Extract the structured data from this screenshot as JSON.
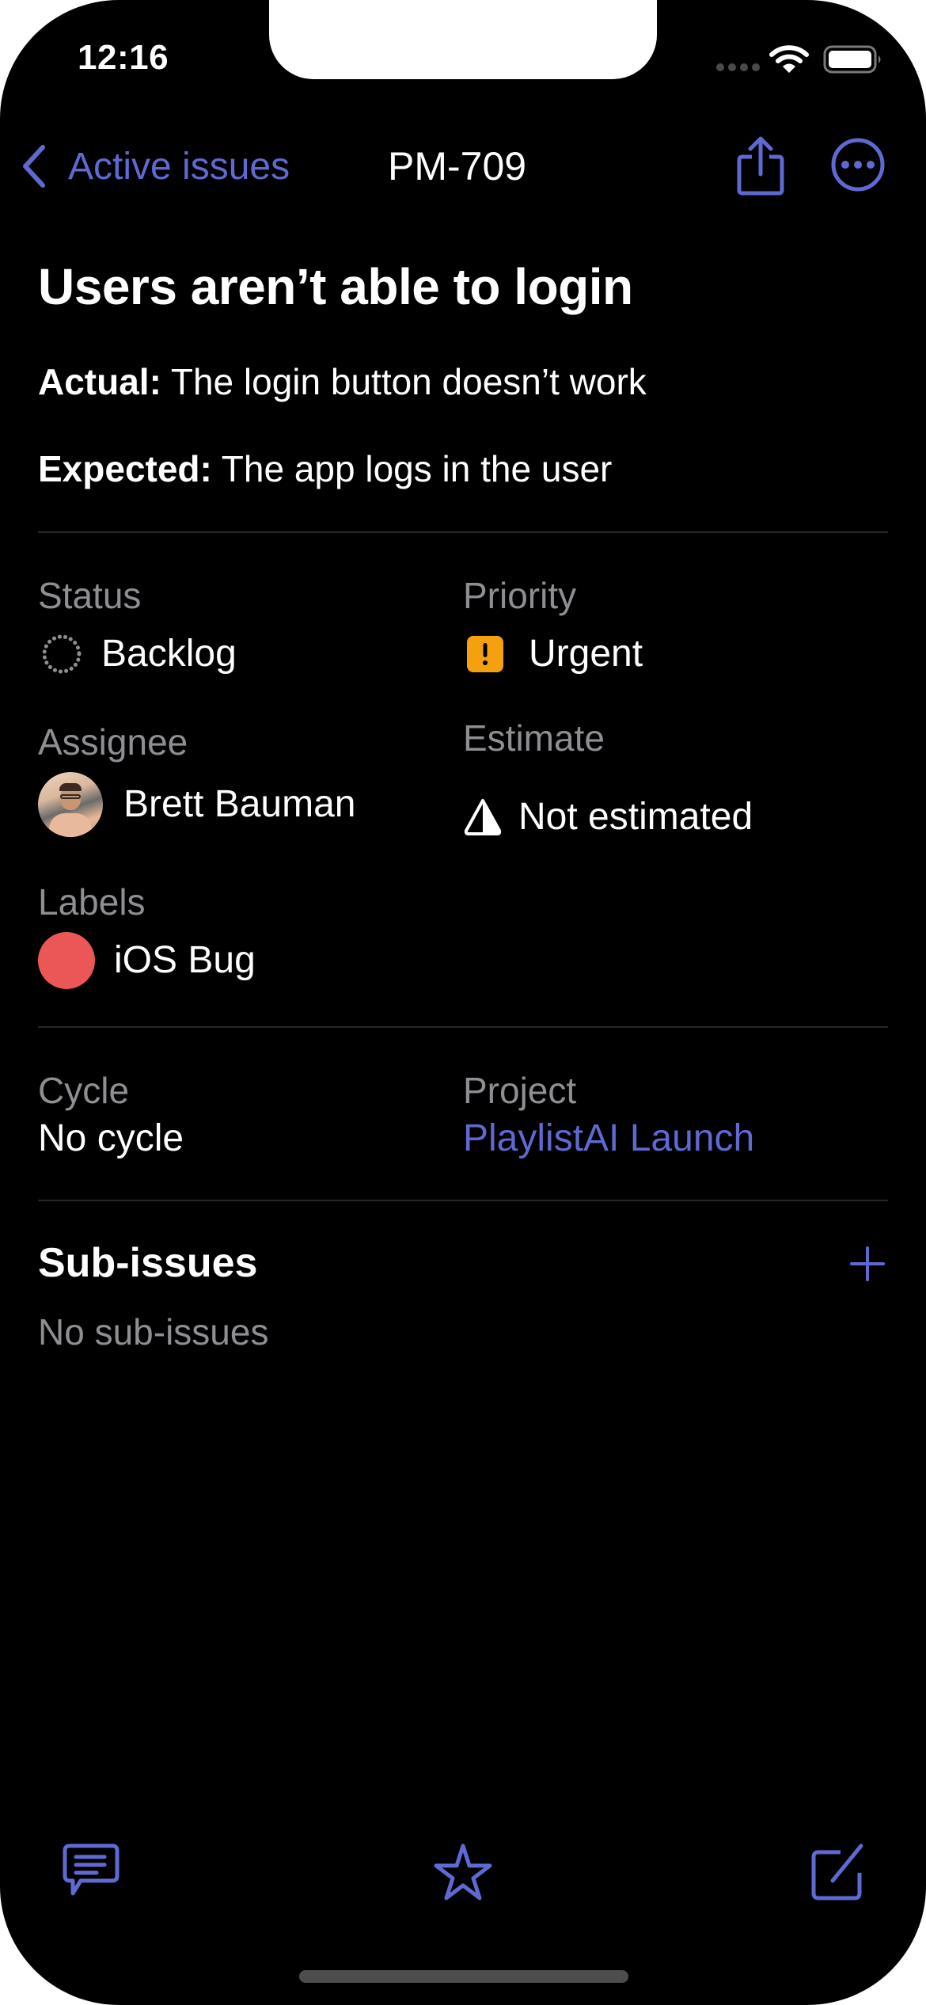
{
  "status_bar": {
    "time": "12:16",
    "signal_icon": "cellular-signal-icon",
    "wifi_icon": "wifi-icon",
    "battery_icon": "battery-icon"
  },
  "nav": {
    "back_label": "Active issues",
    "back_icon": "chevron-left-icon",
    "title": "PM-709",
    "share_icon": "share-icon",
    "more_icon": "ellipsis-circle-icon"
  },
  "issue": {
    "title": "Users aren’t able to login",
    "description": [
      {
        "label": "Actual:",
        "text": " The login button doesn’t work"
      },
      {
        "label": "Expected:",
        "text": " The app logs in the user"
      }
    ]
  },
  "properties": {
    "status": {
      "label": "Status",
      "value": "Backlog",
      "icon": "backlog-dotted-circle-icon"
    },
    "priority": {
      "label": "Priority",
      "value": "Urgent",
      "icon": "urgent-exclamation-icon",
      "color": "#F5A00F"
    },
    "assignee": {
      "label": "Assignee",
      "value": "Brett Bauman",
      "icon": "avatar"
    },
    "estimate": {
      "label": "Estimate",
      "value": "Not estimated",
      "icon": "estimate-triangle-icon"
    },
    "labels": {
      "label": "Labels",
      "items": [
        {
          "name": "iOS Bug",
          "color": "#EB5757"
        }
      ]
    },
    "cycle": {
      "label": "Cycle",
      "value": "No cycle"
    },
    "project": {
      "label": "Project",
      "value": "PlaylistAI Launch"
    }
  },
  "sub_issues": {
    "title": "Sub-issues",
    "empty_text": "No sub-issues",
    "add_icon": "plus-icon"
  },
  "toolbar": {
    "comment_icon": "comment-icon",
    "favorite_icon": "star-icon",
    "edit_icon": "compose-icon"
  },
  "colors": {
    "accent": "#5E6AD2",
    "background": "#000000",
    "secondary_text": "#8E8E93",
    "urgent": "#F5A00F",
    "label_ios_bug": "#EB5757"
  }
}
